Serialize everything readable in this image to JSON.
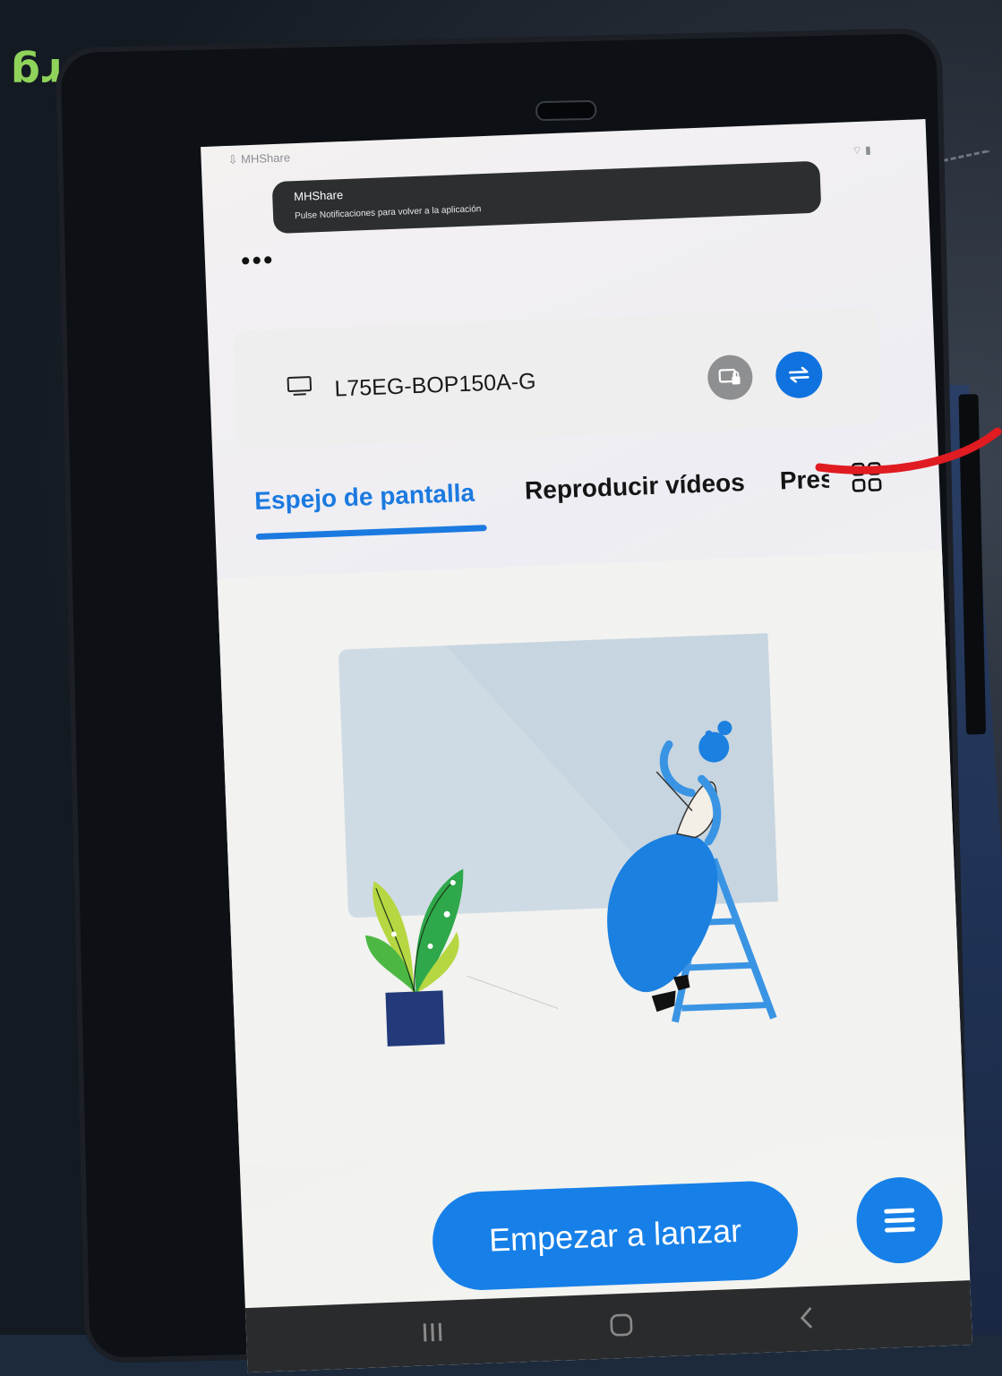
{
  "status_bar": {
    "app_name": "MHShare",
    "icons": "⌔ ▮"
  },
  "notification": {
    "title": "MHShare",
    "message": "Pulse Notificaciones para volver a la aplicación"
  },
  "toolbar": {
    "more_label": "•••"
  },
  "device": {
    "name": "L75EG-BOP150A-G"
  },
  "tabs": [
    {
      "label": "Espejo de pantalla",
      "active": true
    },
    {
      "label": "Reproducir vídeos",
      "active": false
    },
    {
      "label": "Pres",
      "active": false
    }
  ],
  "actions": {
    "start_label": "Empezar a lanzar"
  },
  "colors": {
    "accent": "#1780e8",
    "annotation": "#e01b22",
    "toast_bg": "#2c2e30"
  }
}
